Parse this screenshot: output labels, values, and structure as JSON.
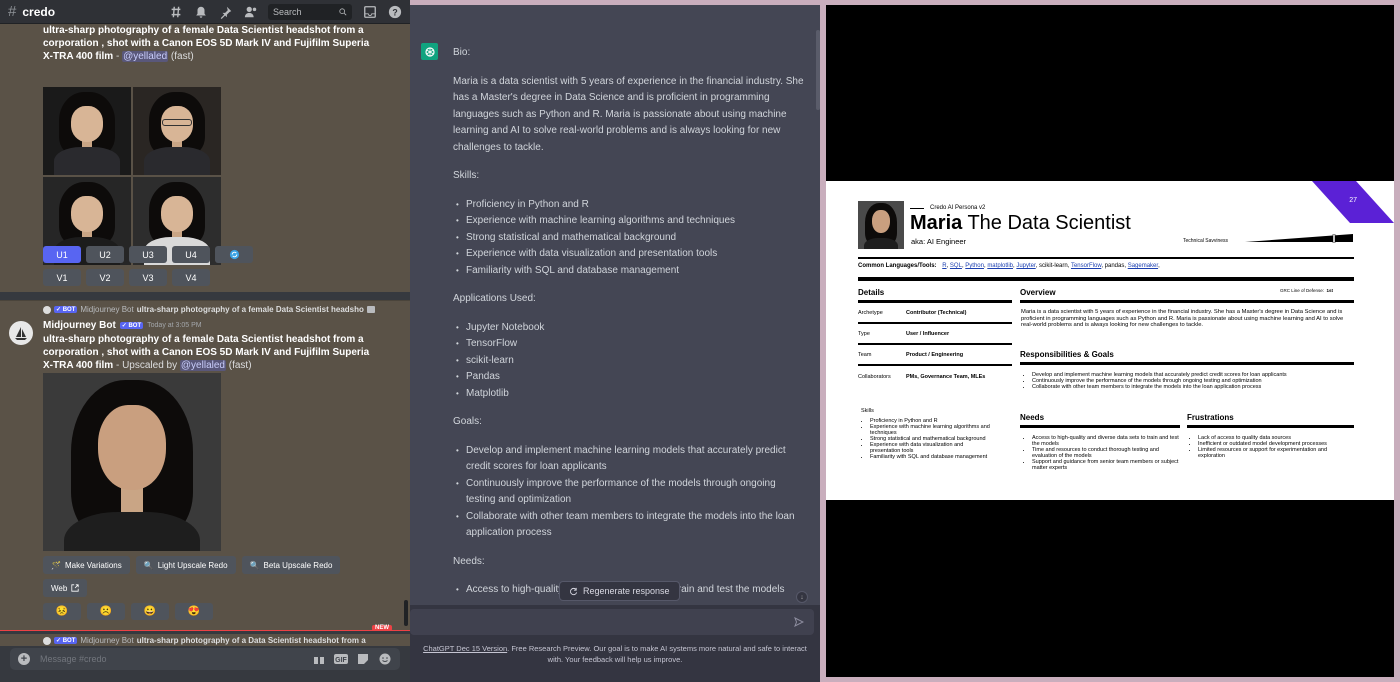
{
  "discord": {
    "channel": "credo",
    "search_placeholder": "Search",
    "msg1": {
      "prompt": "ultra-sharp photography of a female Data Scientist headshot from a corporation , shot with a Canon EOS 5D Mark IV and Fujifilm Superia X-TRA 400 film",
      "sep": " - ",
      "mention": "@yellaled",
      "speed": " (fast)",
      "upscale_buttons": [
        "U1",
        "U2",
        "U3",
        "U4"
      ],
      "variation_buttons": [
        "V1",
        "V2",
        "V3",
        "V4"
      ]
    },
    "msg2": {
      "reply_bot_label": "BOT",
      "reply_author": "Midjourney Bot",
      "reply_text": "ultra-sharp photography of a female Data Scientist headsho",
      "author": "Midjourney Bot",
      "bot_label": "✓ BOT",
      "timestamp": "Today at 3:05 PM",
      "prompt": "ultra-sharp photography of a female Data Scientist headshot from a corporation , shot with a Canon EOS 5D Mark IV and Fujifilm Superia X-TRA 400 film",
      "upscaled_by": " - Upscaled by ",
      "mention": "@yellaled",
      "speed": " (fast)",
      "actions": [
        "Make Variations",
        "Light Upscale Redo",
        "Beta Upscale Redo"
      ],
      "web_label": "Web",
      "emojis": [
        "😣",
        "☹️",
        "😀",
        "😍"
      ]
    },
    "new_label": "NEW",
    "msg3": {
      "bot_label": "✓ BOT",
      "author": "Midjourney Bot",
      "text": "ultra-sharp photography of a Data Scientist headshot from a"
    },
    "composer_placeholder": "Message #credo"
  },
  "chatgpt": {
    "bio_h": "Bio:",
    "bio": "Maria is a data scientist with 5 years of experience in the financial industry. She has a Master's degree in Data Science and is proficient in programming languages such as Python and R. Maria is passionate about using machine learning and AI to solve real-world problems and is always looking for new challenges to tackle.",
    "skills_h": "Skills:",
    "skills": [
      "Proficiency in Python and R",
      "Experience with machine learning algorithms and techniques",
      "Strong statistical and mathematical background",
      "Experience with data visualization and presentation tools",
      "Familiarity with SQL and database management"
    ],
    "apps_h": "Applications Used:",
    "apps": [
      "Jupyter Notebook",
      "TensorFlow",
      "scikit-learn",
      "Pandas",
      "Matplotlib"
    ],
    "goals_h": "Goals:",
    "goals": [
      "Develop and implement machine learning models that accurately predict credit scores for loan applicants",
      "Continuously improve the performance of the models through ongoing testing and optimization",
      "Collaborate with other team members to integrate the models into the loan application process"
    ],
    "needs_h": "Needs:",
    "needs": [
      "Access to high-quality and diverse data sets to train and test the models"
    ],
    "regenerate": "Regenerate response",
    "footer_link": "ChatGPT Dec 15 Version",
    "footer_text": ". Free Research Preview. Our goal is to make AI systems more natural and safe to interact with. Your feedback will help us improve."
  },
  "persona": {
    "page_number": "27",
    "label": "Credo AI Persona v2",
    "name": "Maria",
    "role": " The Data Scientist",
    "aka": "aka: AI Engineer",
    "savviness_label": "Technical Savviness",
    "languages_label": "Common Languages/Tools:",
    "languages": [
      "R",
      "SQL",
      "Python",
      "matplotlib",
      "Jupyter",
      "scikit-learn",
      "TensorFlow",
      "pandas",
      "Sagemaker"
    ],
    "lang_plain": [
      "scikit-learn"
    ],
    "grc_label": "GRC Line of Defense:",
    "grc_value": "1st",
    "details_h": "Details",
    "details": [
      {
        "k": "Archetype",
        "v": "Contributor (Technical)"
      },
      {
        "k": "Type",
        "v": "User / Influencer"
      },
      {
        "k": "Team",
        "v": "Product / Engineering"
      },
      {
        "k": "Collaborators",
        "v": "PMs, Governance Team, MLEs"
      }
    ],
    "skills_h": "Skills",
    "skills": [
      "Proficiency in Python and R",
      "Experience with machine learning algorithms and techniques",
      "Strong statistical and mathematical background",
      "Experience with data visualization and presentation tools",
      "Familiarity with SQL and database management"
    ],
    "overview_h": "Overview",
    "overview": "Maria is a data scientist with 5 years of experience in the financial industry. She has a Master's degree in Data Science and is proficient in programming languages such as Python and R. Maria is passionate about using machine learning and AI to solve real-world problems and is always looking for new challenges to tackle.",
    "resp_h": "Responsibilities & Goals",
    "resp": [
      "Develop and implement machine learning models that accurately predict credit scores for loan applicants",
      "Continuously improve the performance of the models through ongoing testing and optimization",
      "Collaborate with other team members to integrate the models into the loan application process"
    ],
    "needs_h": "Needs",
    "needs": [
      "Access to high-quality and diverse data sets to train and test the models",
      "Time and resources to conduct thorough testing and evaluation of the models",
      "Support and guidance from senior team members or subject matter experts"
    ],
    "frust_h": "Frustrations",
    "frust": [
      "Lack of access to quality data sources",
      "Inefficient or outdated model development processes",
      "Limited resources or support for experimentation and exploration"
    ],
    "accent_color": "#5b21d6"
  }
}
